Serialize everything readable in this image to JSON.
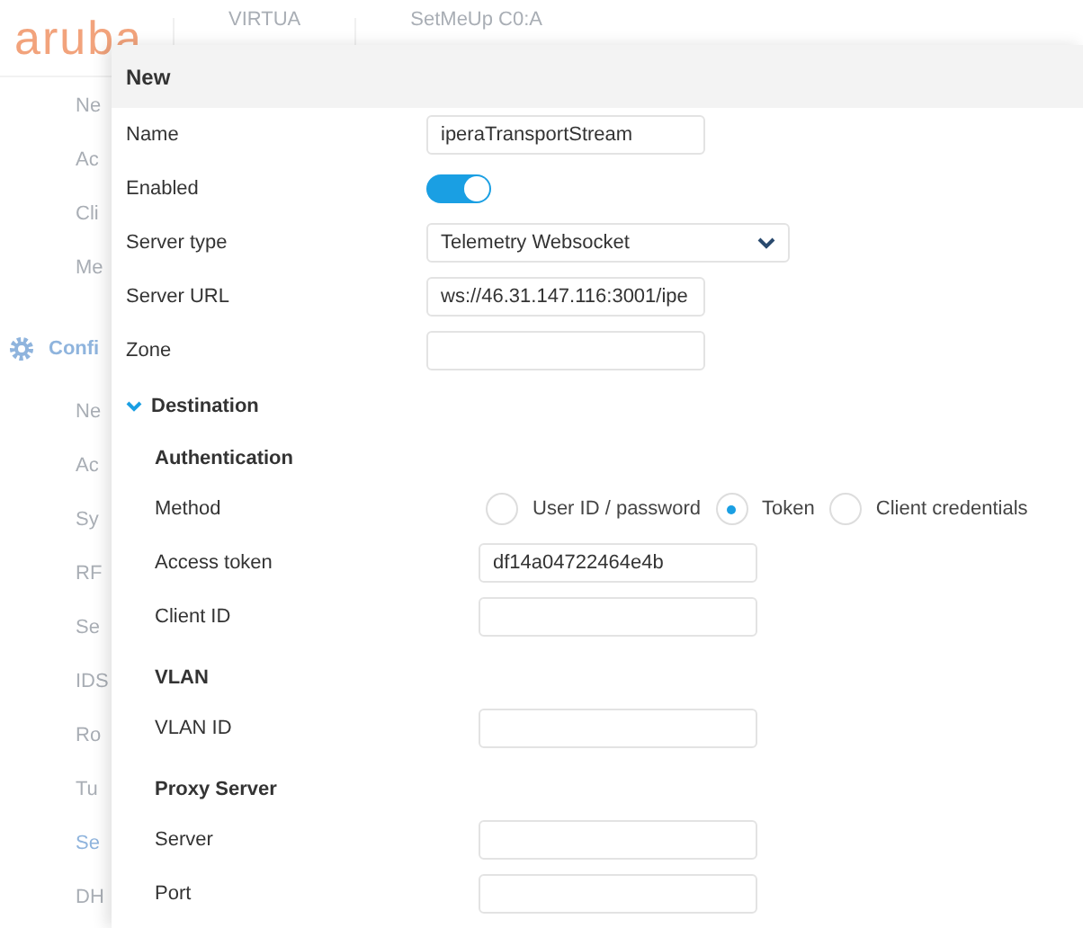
{
  "background": {
    "logo": "aruba",
    "header_items": [
      "VIRTUA",
      "SetMeUp C0:A"
    ],
    "sidebar": [
      {
        "label": "Ne",
        "kind": "item"
      },
      {
        "label": "Ac",
        "kind": "item"
      },
      {
        "label": "Cli",
        "kind": "item"
      },
      {
        "label": "Me",
        "kind": "item"
      },
      {
        "label": "Confi",
        "kind": "section"
      },
      {
        "label": "Ne",
        "kind": "item"
      },
      {
        "label": "Ac",
        "kind": "item"
      },
      {
        "label": "Sy",
        "kind": "item"
      },
      {
        "label": "RF",
        "kind": "item"
      },
      {
        "label": "Se",
        "kind": "item"
      },
      {
        "label": "IDS",
        "kind": "item"
      },
      {
        "label": "Ro",
        "kind": "item"
      },
      {
        "label": "Tu",
        "kind": "item"
      },
      {
        "label": "Se",
        "kind": "link"
      },
      {
        "label": "DH",
        "kind": "item"
      }
    ]
  },
  "dialog": {
    "title": "New",
    "fields": [
      {
        "kind": "text",
        "label": "Name",
        "value": "iperaTransportStream"
      },
      {
        "kind": "toggle",
        "label": "Enabled",
        "on": true
      },
      {
        "kind": "select",
        "label": "Server type",
        "value": "Telemetry Websocket"
      },
      {
        "kind": "text",
        "label": "Server URL",
        "value": "ws://46.31.147.116:3001/ipe"
      },
      {
        "kind": "text",
        "label": "Zone"
      }
    ],
    "destination": {
      "label": "Destination",
      "expanded": true,
      "groups": [
        {
          "title": "Authentication",
          "fields": [
            {
              "kind": "radio",
              "label": "Method",
              "options": [
                {
                  "label": "User ID / password",
                  "selected": false
                },
                {
                  "label": "Token",
                  "selected": true
                },
                {
                  "label": "Client credentials",
                  "selected": false
                }
              ]
            },
            {
              "kind": "text",
              "label": "Access token",
              "value": "df14a04722464e4b"
            },
            {
              "kind": "text",
              "label": "Client ID"
            }
          ]
        },
        {
          "title": "VLAN",
          "fields": [
            {
              "kind": "text",
              "label": "VLAN ID"
            }
          ]
        },
        {
          "title": "Proxy Server",
          "fields": [
            {
              "kind": "text",
              "label": "Server"
            },
            {
              "kind": "text",
              "label": "Port"
            }
          ]
        }
      ]
    }
  }
}
